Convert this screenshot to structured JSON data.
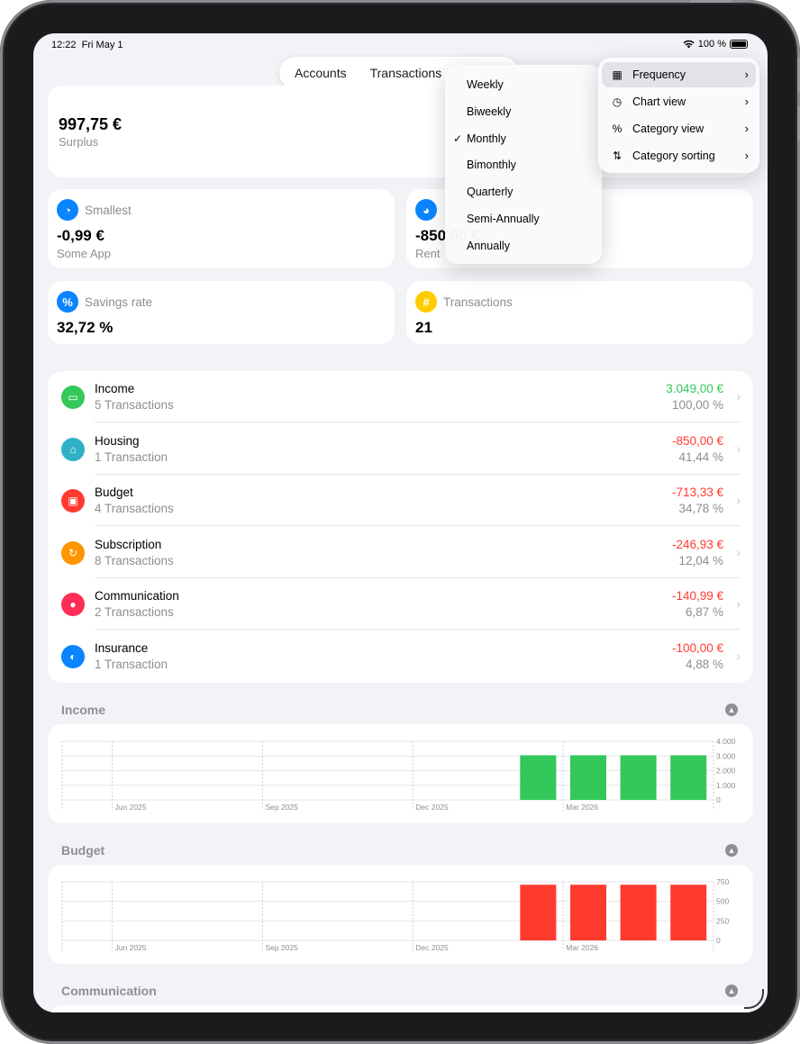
{
  "status": {
    "time": "12:22",
    "date": "Fri May 1",
    "battery": "100 %"
  },
  "tabs": [
    {
      "label": "Accounts"
    },
    {
      "label": "Transactions"
    }
  ],
  "summary": {
    "value": "997,75 €",
    "label": "Surplus"
  },
  "stats": [
    {
      "label": "Smallest",
      "value": "-0,99 €",
      "sub": "Some App",
      "icon": "gauge-icon",
      "color": "#0a84ff"
    },
    {
      "label": "",
      "value": "-850,00 €",
      "sub": "Rent",
      "icon": "gauge-icon",
      "color": "#0a84ff"
    },
    {
      "label": "Savings rate",
      "value": "32,72 %",
      "sub": "",
      "icon": "percent-icon",
      "color": "#0a84ff"
    },
    {
      "label": "Transactions",
      "value": "21",
      "sub": "",
      "icon": "hash-icon",
      "color": "#ffcc00"
    }
  ],
  "categories": [
    {
      "name": "Income",
      "count": "5 Transactions",
      "amount": "3.049,00 €",
      "percent": "100,00 %",
      "color": "#34c759",
      "icon": "banknote-icon",
      "amount_color": "#34c759"
    },
    {
      "name": "Housing",
      "count": "1 Transaction",
      "amount": "-850,00 €",
      "percent": "41,44 %",
      "color": "#30b0c7",
      "icon": "house-icon",
      "amount_color": "#ff3b30"
    },
    {
      "name": "Budget",
      "count": "4 Transactions",
      "amount": "-713,33 €",
      "percent": "34,78 %",
      "color": "#ff3b30",
      "icon": "wallet-icon",
      "amount_color": "#ff3b30"
    },
    {
      "name": "Subscription",
      "count": "8 Transactions",
      "amount": "-246,93 €",
      "percent": "12,04 %",
      "color": "#ff9500",
      "icon": "recurring-icon",
      "amount_color": "#ff3b30"
    },
    {
      "name": "Communication",
      "count": "2 Transactions",
      "amount": "-140,99 €",
      "percent": "6,87 %",
      "color": "#ff2d55",
      "icon": "message-icon",
      "amount_color": "#ff3b30"
    },
    {
      "name": "Insurance",
      "count": "1 Transaction",
      "amount": "-100,00 €",
      "percent": "4,88 %",
      "color": "#0a84ff",
      "icon": "shield-icon",
      "amount_color": "#ff3b30"
    }
  ],
  "sections": {
    "income": "Income",
    "budget": "Budget",
    "communication": "Communication"
  },
  "frequency_menu": {
    "items": [
      "Weekly",
      "Biweekly",
      "Monthly",
      "Bimonthly",
      "Quarterly",
      "Semi-Annually",
      "Annually"
    ],
    "selected": "Monthly",
    "check_glyph": "✓"
  },
  "options_menu": [
    {
      "label": "Frequency",
      "icon": "calendar-icon"
    },
    {
      "label": "Chart view",
      "icon": "pie-chart-icon"
    },
    {
      "label": "Category view",
      "icon": "percent-icon"
    },
    {
      "label": "Category sorting",
      "icon": "sort-icon"
    }
  ],
  "chart_data": [
    {
      "type": "bar",
      "categories": [
        "Jun 2025",
        "Sep 2025",
        "Dec 2025",
        "Mar 2026"
      ],
      "x_labels": [
        "Jun 2025",
        "Sep 2025",
        "Dec 2025",
        "Mar 2026"
      ],
      "series": [
        {
          "values": [
            0,
            0,
            0,
            0,
            0,
            0,
            0,
            0,
            0,
            3049,
            3049,
            3049,
            3049
          ],
          "color": "#34c759"
        }
      ],
      "months": [
        "2025-05",
        "2025-06",
        "2025-07",
        "2025-08",
        "2025-09",
        "2025-10",
        "2025-11",
        "2025-12",
        "2026-01",
        "2026-02",
        "2026-03",
        "2026-04",
        "2026-05"
      ],
      "y_ticks": [
        "4.000",
        "3.000",
        "2.000",
        "1.000",
        "0"
      ],
      "ylim": [
        0,
        4000
      ],
      "grid": true
    },
    {
      "type": "bar",
      "categories": [
        "Jun 2025",
        "Sep 2025",
        "Dec 2025",
        "Mar 2026"
      ],
      "x_labels": [
        "Jun 2025",
        "Sep 2025",
        "Dec 2025",
        "Mar 2026"
      ],
      "series": [
        {
          "values": [
            0,
            0,
            0,
            0,
            0,
            0,
            0,
            0,
            0,
            713.33,
            713.33,
            713.33,
            713.33
          ],
          "color": "#ff3b30"
        }
      ],
      "months": [
        "2025-05",
        "2025-06",
        "2025-07",
        "2025-08",
        "2025-09",
        "2025-10",
        "2025-11",
        "2025-12",
        "2026-01",
        "2026-02",
        "2026-03",
        "2026-04",
        "2026-05"
      ],
      "y_ticks": [
        "750",
        "500",
        "250",
        "0"
      ],
      "ylim": [
        0,
        750
      ],
      "grid": true
    }
  ]
}
